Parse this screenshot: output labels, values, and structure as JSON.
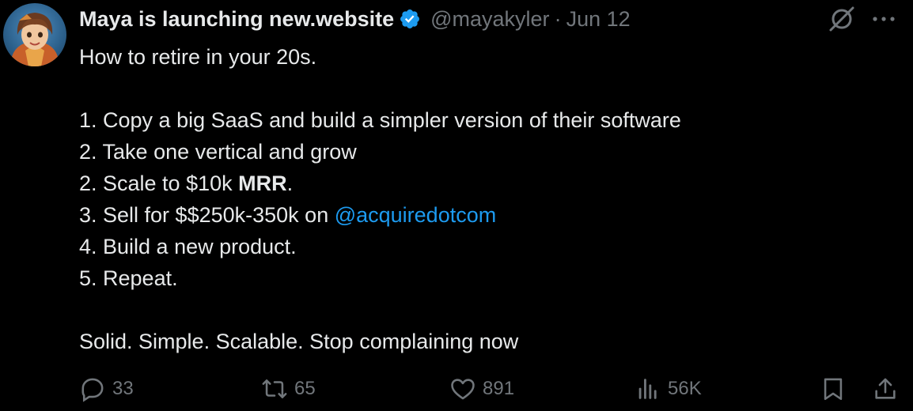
{
  "tweet": {
    "display_name": "Maya is launching new.website",
    "handle": "@mayakyler",
    "separator": "·",
    "date": "Jun 12",
    "body": {
      "line1": "How to retire in your 20s.",
      "line2": "1. Copy a big SaaS and build a simpler version of their software",
      "line3": "2. Take one vertical and grow",
      "line4_prefix": "2. Scale to $10k ",
      "line4_bold": "MRR",
      "line4_suffix": ".",
      "line5_prefix": "3. Sell for $$250k-350k on ",
      "line5_mention": "@acquiredotcom",
      "line6": "4. Build a new product.",
      "line7": "5. Repeat.",
      "line8": "Solid. Simple. Scalable. Stop complaining now"
    },
    "stats": {
      "replies": "33",
      "reposts": "65",
      "likes": "891",
      "views": "56K"
    }
  },
  "colors": {
    "background": "#000000",
    "text": "#e7e9ea",
    "secondary": "#71767b",
    "link": "#1d9bf0",
    "verified": "#1d9bf0"
  },
  "icons": [
    "avatar",
    "verified-badge-icon",
    "grok-icon",
    "more-icon",
    "reply-icon",
    "repost-icon",
    "like-icon",
    "views-icon",
    "bookmark-icon",
    "share-icon"
  ]
}
